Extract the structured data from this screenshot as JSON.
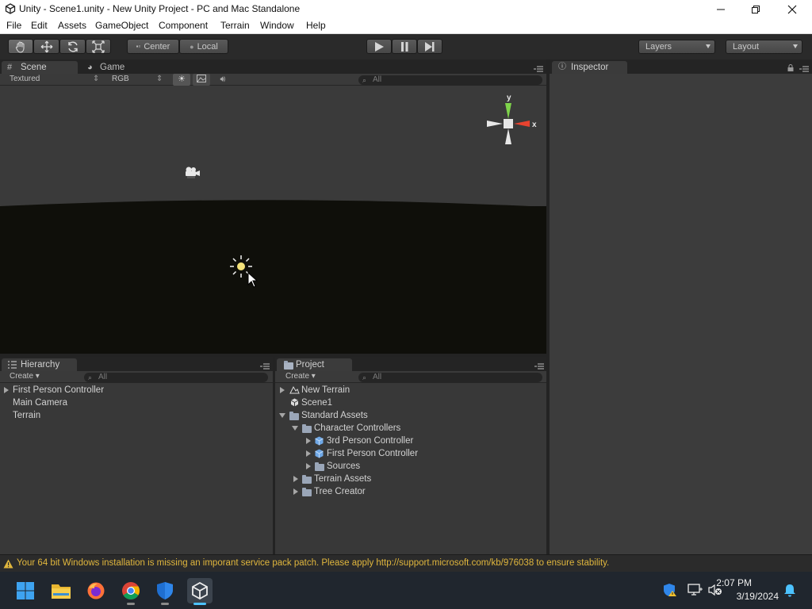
{
  "window": {
    "title": "Unity - Scene1.unity - New Unity Project - PC and Mac Standalone",
    "controls": [
      "minimize",
      "maximize",
      "close"
    ]
  },
  "menu": [
    "File",
    "Edit",
    "Assets",
    "GameObject",
    "Component",
    "Terrain",
    "Window",
    "Help"
  ],
  "toolbar": {
    "tools": [
      "hand-icon",
      "move-icon",
      "rotate-icon",
      "scale-icon"
    ],
    "pivot": "Center",
    "space": "Local",
    "playback": [
      "play-icon",
      "pause-icon",
      "step-icon"
    ],
    "layers_label": "Layers",
    "layout_label": "Layout"
  },
  "scene_panel": {
    "tabs": [
      "Scene",
      "Game"
    ],
    "render_mode": "Textured",
    "channel": "RGB",
    "search_placeholder": "All",
    "gizmo": {
      "y": "y",
      "x": "x"
    }
  },
  "inspector": {
    "title": "Inspector"
  },
  "hierarchy": {
    "title": "Hierarchy",
    "create_label": "Create",
    "search_placeholder": "All",
    "items": [
      {
        "label": "First Person Controller",
        "expandable": true
      },
      {
        "label": "Main Camera",
        "expandable": false
      },
      {
        "label": "Terrain",
        "expandable": false
      }
    ]
  },
  "project": {
    "title": "Project",
    "create_label": "Create",
    "search_placeholder": "All",
    "items": [
      {
        "label": "New Terrain",
        "icon": "terrain-icon",
        "indent": 0,
        "toggle": "right"
      },
      {
        "label": "Scene1",
        "icon": "unity-scene-icon",
        "indent": 0,
        "toggle": "none"
      },
      {
        "label": "Standard Assets",
        "icon": "folder-icon",
        "indent": 0,
        "toggle": "down"
      },
      {
        "label": "Character Controllers",
        "icon": "folder-icon",
        "indent": 1,
        "toggle": "down"
      },
      {
        "label": "3rd Person Controller",
        "icon": "prefab-icon",
        "indent": 2,
        "toggle": "right"
      },
      {
        "label": "First Person Controller",
        "icon": "prefab-icon",
        "indent": 2,
        "toggle": "right"
      },
      {
        "label": "Sources",
        "icon": "folder-icon",
        "indent": 2,
        "toggle": "right"
      },
      {
        "label": "Terrain Assets",
        "icon": "folder-icon",
        "indent": 1,
        "toggle": "right"
      },
      {
        "label": "Tree Creator",
        "icon": "folder-icon",
        "indent": 1,
        "toggle": "right"
      }
    ]
  },
  "status": {
    "message": "Your 64 bit Windows installation is missing an imporant service pack patch. Please apply http://support.microsoft.com/kb/976038 to ensure stability.",
    "color": "#e0b63d"
  },
  "taskbar": {
    "apps": [
      "windows-start-icon",
      "file-explorer-icon",
      "firefox-icon",
      "chrome-icon",
      "windows-security-icon",
      "unity-icon"
    ],
    "time": "2:07 PM",
    "date": "3/19/2024"
  }
}
